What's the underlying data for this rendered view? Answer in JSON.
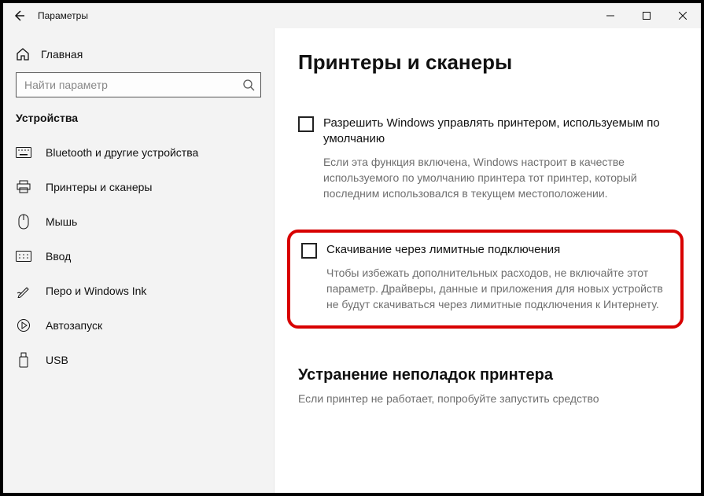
{
  "titlebar": {
    "title": "Параметры"
  },
  "sidebar": {
    "home": "Главная",
    "search_placeholder": "Найти параметр",
    "section": "Устройства",
    "items": [
      {
        "label": "Bluetooth и другие устройства"
      },
      {
        "label": "Принтеры и сканеры"
      },
      {
        "label": "Мышь"
      },
      {
        "label": "Ввод"
      },
      {
        "label": "Перо и Windows Ink"
      },
      {
        "label": "Автозапуск"
      },
      {
        "label": "USB"
      }
    ]
  },
  "content": {
    "page_title": "Принтеры и сканеры",
    "default_printer": {
      "label": "Разрешить Windows управлять принтером, используемым по умолчанию",
      "desc": "Если эта функция включена, Windows настроит в качестве используемого по умолчанию принтера тот принтер, который последним использовался в текущем местоположении."
    },
    "metered": {
      "label": "Скачивание через лимитные подключения",
      "desc": "Чтобы избежать дополнительных расходов, не включайте этот параметр. Драйверы, данные и приложения для новых устройств не будут скачиваться через лимитные подключения к Интернету."
    },
    "troubleshoot": {
      "heading": "Устранение неполадок принтера",
      "truncated": "Если принтер не работает, попробуйте запустить средство"
    }
  }
}
